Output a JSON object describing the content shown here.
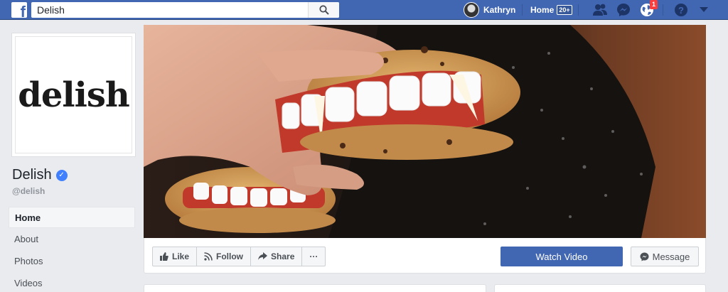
{
  "topbar": {
    "search_value": "Delish",
    "user_name": "Kathryn",
    "home_label": "Home",
    "home_count": "20+",
    "notification_count": "1"
  },
  "page": {
    "logo_text": "delish",
    "name": "Delish",
    "handle": "@delish"
  },
  "nav": {
    "items": [
      {
        "label": "Home"
      },
      {
        "label": "About"
      },
      {
        "label": "Photos"
      },
      {
        "label": "Videos"
      }
    ]
  },
  "actions": {
    "like": "Like",
    "follow": "Follow",
    "share": "Share",
    "more": "···",
    "watch_video": "Watch Video",
    "message": "Message"
  },
  "colors": {
    "brand_blue": "#4267b2",
    "background": "#e9ebee",
    "badge_red": "#fa3e3e",
    "verified_blue": "#4080ff"
  },
  "icons": [
    "facebook-logo-icon",
    "search-icon",
    "friend-requests-icon",
    "messenger-icon",
    "globe-notifications-icon",
    "help-icon",
    "caret-down-icon",
    "verified-icon",
    "like-thumb-icon",
    "rss-follow-icon",
    "share-arrow-icon",
    "message-bubble-icon"
  ]
}
